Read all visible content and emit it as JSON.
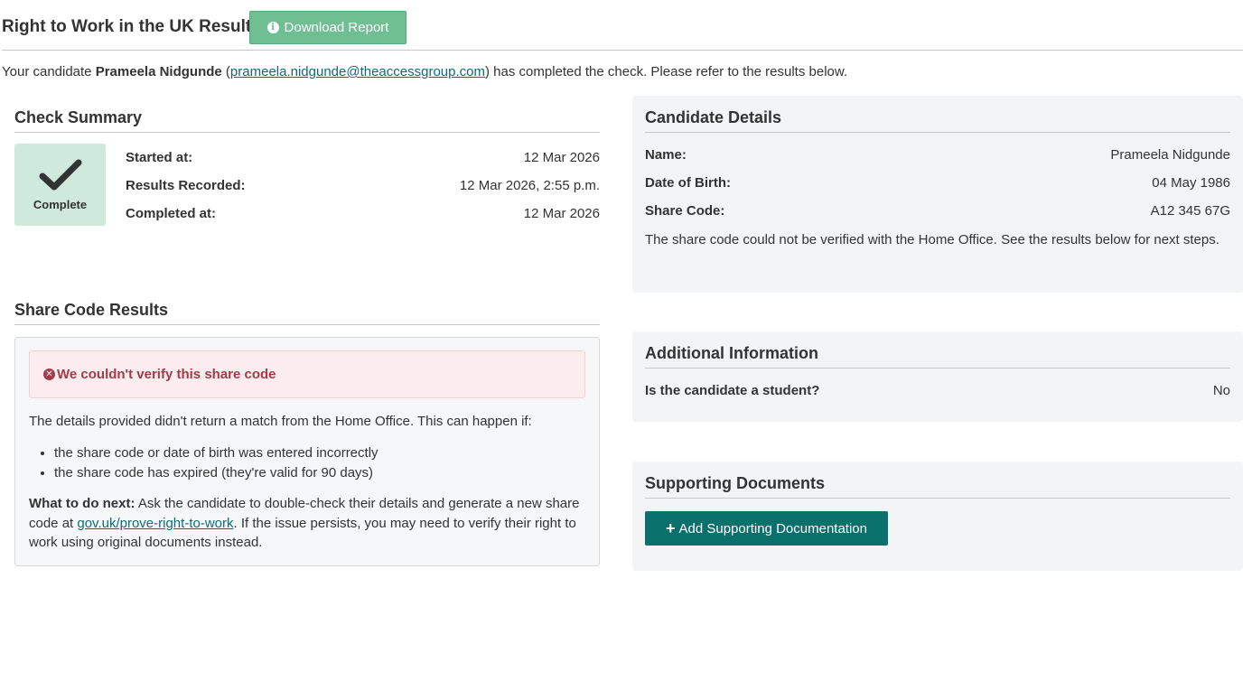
{
  "header": {
    "title": "Right to Work in the UK Result",
    "download_label": "Download Report",
    "download_icon": "info-icon"
  },
  "intro": {
    "prefix": "Your candidate ",
    "candidate_name": "Prameela Nidgunde",
    "open_paren": " (",
    "email": "prameela.nidgunde@theaccessgroup.com",
    "suffix": ") has completed the check. Please refer to the results below."
  },
  "check_summary": {
    "title": "Check Summary",
    "status_label": "Complete",
    "status_icon": "checkmark-icon",
    "rows": [
      {
        "label": "Started at:",
        "value": "12 Mar 2026"
      },
      {
        "label": "Results Recorded:",
        "value": "12 Mar 2026, 2:55 p.m."
      },
      {
        "label": "Completed at:",
        "value": "12 Mar 2026"
      }
    ]
  },
  "share_code_results": {
    "title": "Share Code Results",
    "alert_text": "We couldn't verify this share code",
    "alert_icon": "error-circle-icon",
    "description": "The details provided didn't return a match from the Home Office. This can happen if:",
    "reasons": [
      "the share code or date of birth was entered incorrectly",
      "the share code has expired (they're valid for 90 days)"
    ],
    "next_label": "What to do next:",
    "next_text_1": " Ask the candidate to double-check their details and generate a new share code at ",
    "next_link": "gov.uk/prove-right-to-work",
    "next_text_2": ". If the issue persists, you may need to verify their right to work using original documents instead."
  },
  "candidate_details": {
    "title": "Candidate Details",
    "rows": [
      {
        "label": "Name:",
        "value": "Prameela Nidgunde"
      },
      {
        "label": "Date of Birth:",
        "value": "04 May 1986"
      },
      {
        "label": "Share Code:",
        "value": "A12 345 67G"
      }
    ],
    "note": "The share code could not be verified with the Home Office. See the results below for next steps."
  },
  "additional_information": {
    "title": "Additional Information",
    "rows": [
      {
        "label": "Is the candidate a student?",
        "value": "No"
      }
    ]
  },
  "supporting_documents": {
    "title": "Supporting Documents",
    "add_label": "Add Supporting Documentation",
    "add_icon": "plus-icon"
  },
  "colors": {
    "download_button": "#6fbf93",
    "complete_tile": "#cfe9dc",
    "alert_text": "#a23b4a",
    "alert_bg": "#fbecee",
    "primary_button": "#0a706c",
    "link": "#0a6e74",
    "panel_bg": "#f3f4f6"
  }
}
